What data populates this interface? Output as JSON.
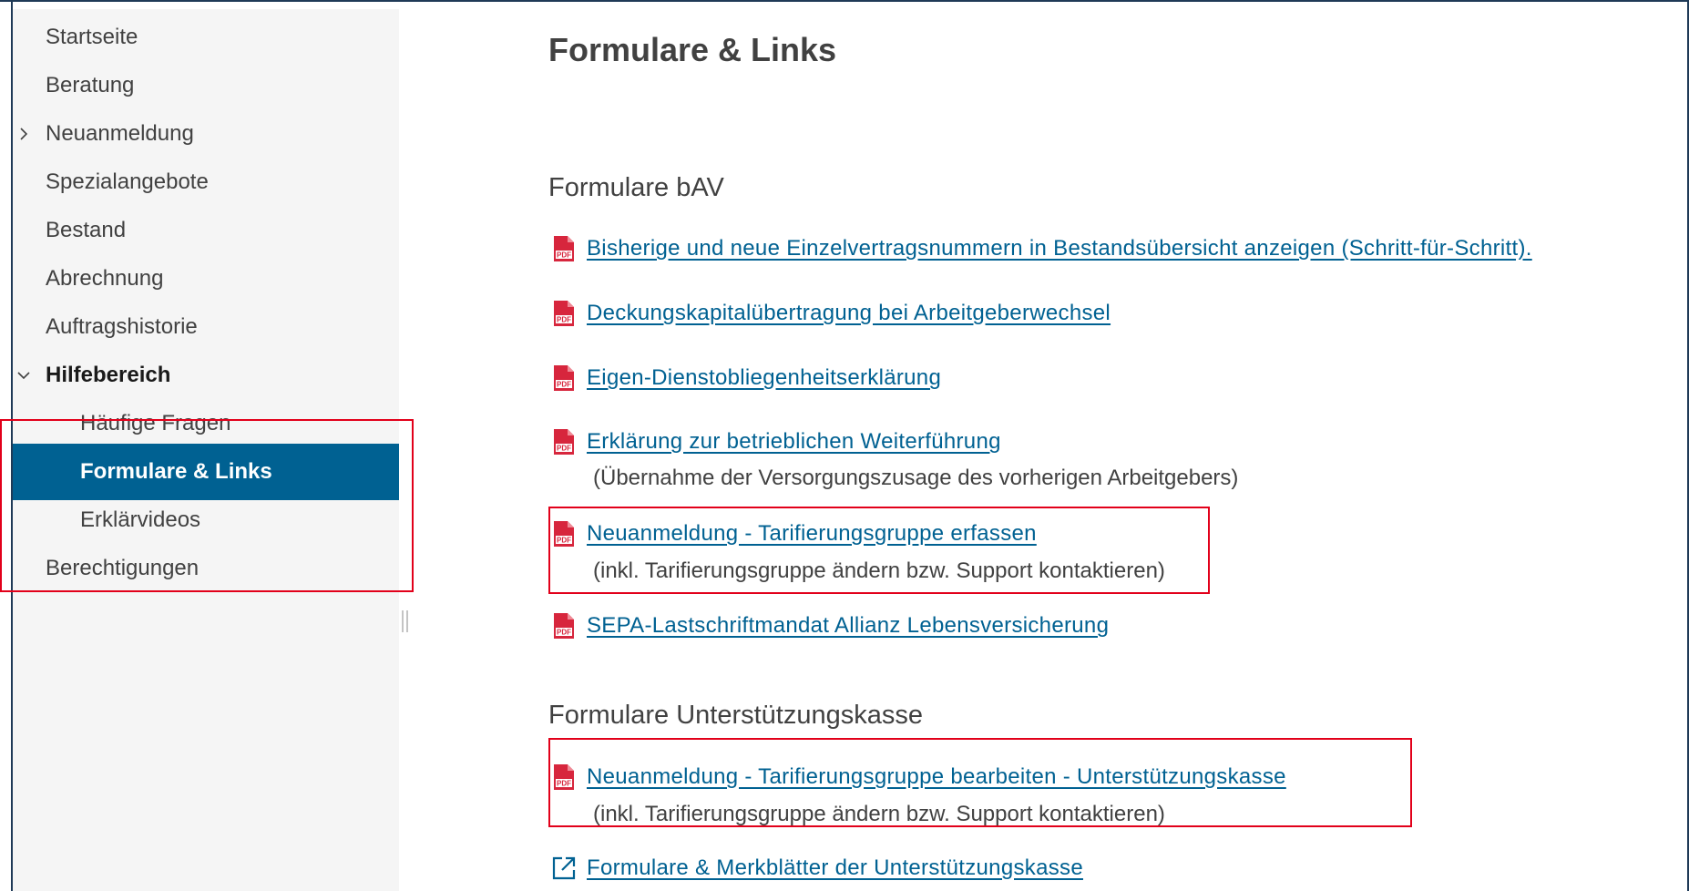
{
  "sidebar": {
    "items": [
      {
        "label": "Startseite"
      },
      {
        "label": "Beratung"
      },
      {
        "label": "Neuanmeldung"
      },
      {
        "label": "Spezialangebote"
      },
      {
        "label": "Bestand"
      },
      {
        "label": "Abrechnung"
      },
      {
        "label": "Auftragshistorie"
      },
      {
        "label": "Hilfebereich"
      },
      {
        "label": "Häufige Fragen"
      },
      {
        "label": "Formulare & Links"
      },
      {
        "label": "Erklärvideos"
      },
      {
        "label": "Berechtigungen"
      }
    ]
  },
  "main": {
    "title": "Formulare & Links",
    "sections": [
      {
        "title": "Formulare bAV",
        "links": [
          {
            "label": "Bisherige und neue Einzelvertragsnummern in Bestandsübersicht anzeigen (Schritt-für-Schritt).",
            "icon": "pdf-icon"
          },
          {
            "label": "Deckungskapitalübertragung bei Arbeitgeberwechsel",
            "icon": "pdf-icon"
          },
          {
            "label": "Eigen-Dienstobliegenheitserklärung",
            "icon": "pdf-icon"
          },
          {
            "label": "Erklärung zur betrieblichen Weiterführung",
            "note": "(Übernahme der Versorgungszusage des vorherigen Arbeitgebers)",
            "icon": "pdf-icon"
          },
          {
            "label": "Neuanmeldung - Tarifierungsgruppe erfassen",
            "note": "(inkl. Tarifierungsgruppe ändern bzw. Support kontaktieren)",
            "icon": "pdf-icon"
          },
          {
            "label": "SEPA-Lastschriftmandat Allianz Lebensversicherung",
            "icon": "pdf-icon"
          }
        ]
      },
      {
        "title": "Formulare Unterstützungskasse",
        "links": [
          {
            "label": "Neuanmeldung - Tarifierungsgruppe bearbeiten - Unterstützungskasse",
            "note": "(inkl. Tarifierungsgruppe ändern bzw. Support kontaktieren)",
            "icon": "pdf-icon"
          },
          {
            "label": "Formulare & Merkblätter der Unterstützungskasse",
            "icon": "external-link-icon"
          }
        ]
      }
    ]
  },
  "colors": {
    "link": "#006192",
    "active_nav_bg": "#006192",
    "sidebar_bg": "#f5f5f5",
    "highlight_border": "#e2001a",
    "pdf_red": "#d7263d",
    "text": "#414141"
  }
}
